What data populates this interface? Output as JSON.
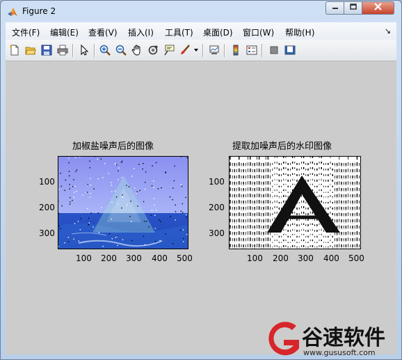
{
  "window": {
    "title": "Figure 2",
    "app_icon": "matlab-icon"
  },
  "window_controls": {
    "minimize": "minimize-icon",
    "maximize": "maximize-icon",
    "close": "close-icon"
  },
  "menu": {
    "items": [
      "文件(F)",
      "编辑(E)",
      "查看(V)",
      "插入(I)",
      "工具(T)",
      "桌面(D)",
      "窗口(W)",
      "帮助(H)"
    ],
    "overflow_arrow": "↘"
  },
  "toolbar": {
    "icons": [
      "new-figure-icon",
      "open-file-icon",
      "save-icon",
      "print-icon",
      "pointer-icon",
      "zoom-in-icon",
      "zoom-out-icon",
      "pan-icon",
      "rotate-3d-icon",
      "data-cursor-icon",
      "brush-icon",
      "brush-dropdown-icon",
      "link-plot-icon",
      "colorbar-icon",
      "legend-icon",
      "hide-plot-tools-icon",
      "show-plot-tools-icon"
    ]
  },
  "plots": [
    {
      "title": "加椒盐噪声后的图像",
      "yticks": [
        "100",
        "200",
        "300"
      ],
      "xticks": [
        "100",
        "200",
        "300",
        "400",
        "500"
      ]
    },
    {
      "title": "提取加噪声后的水印图像",
      "yticks": [
        "100",
        "200",
        "300"
      ],
      "xticks": [
        "100",
        "200",
        "300",
        "400",
        "500"
      ]
    }
  ],
  "watermark": {
    "brand": "谷速软件",
    "url": "www.gususoft.com",
    "brand_color": "#d7262b"
  }
}
